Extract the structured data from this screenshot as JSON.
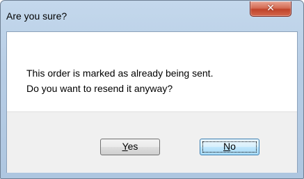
{
  "window": {
    "title": "Are you sure?",
    "close_glyph": "✕"
  },
  "message": {
    "line1": "This order is marked as already being sent.",
    "line2": "Do you want to resend it anyway?"
  },
  "buttons": {
    "yes": {
      "accel": "Y",
      "rest": "es"
    },
    "no": {
      "accel": "N",
      "rest": "o"
    }
  },
  "icons": {
    "close": "close-icon"
  },
  "colors": {
    "title_bar": "#b7cde5",
    "close_button": "#c0442b",
    "footer": "#f0f0f0",
    "default_button_border": "#3c7fb1"
  }
}
